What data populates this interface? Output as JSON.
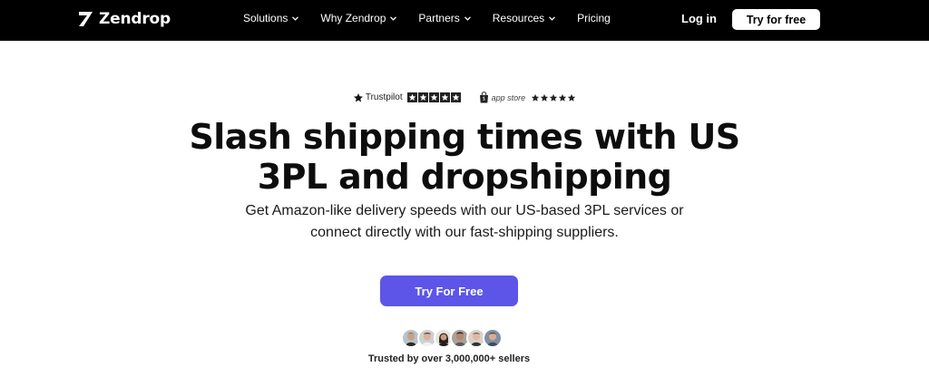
{
  "nav": {
    "brand": "Zendrop",
    "menu": [
      {
        "label": "Solutions",
        "dropdown": true
      },
      {
        "label": "Why Zendrop",
        "dropdown": true
      },
      {
        "label": "Partners",
        "dropdown": true
      },
      {
        "label": "Resources",
        "dropdown": true
      },
      {
        "label": "Pricing",
        "dropdown": false
      }
    ],
    "login": "Log in",
    "cta": "Try for free"
  },
  "ratings": {
    "trustpilot": {
      "label": "Trustpilot",
      "stars": 5
    },
    "app_store": {
      "label": "app store",
      "stars": 5
    }
  },
  "hero": {
    "headline_line1": "Slash shipping times with US",
    "headline_line2": "3PL and dropshipping",
    "sub_line1": "Get Amazon-like delivery speeds with our US-based 3PL services or",
    "sub_line2": "connect directly with our fast-shipping suppliers.",
    "cta": "Try For Free"
  },
  "social_proof": {
    "avatars": [
      "avatar-1",
      "avatar-2",
      "avatar-3",
      "avatar-4",
      "avatar-5",
      "avatar-6"
    ],
    "text": "Trusted by over 3,000,000+ sellers"
  },
  "colors": {
    "nav_bg": "#000000",
    "cta_purple": "#5c55e8",
    "text_dark": "#0d0d0d"
  }
}
